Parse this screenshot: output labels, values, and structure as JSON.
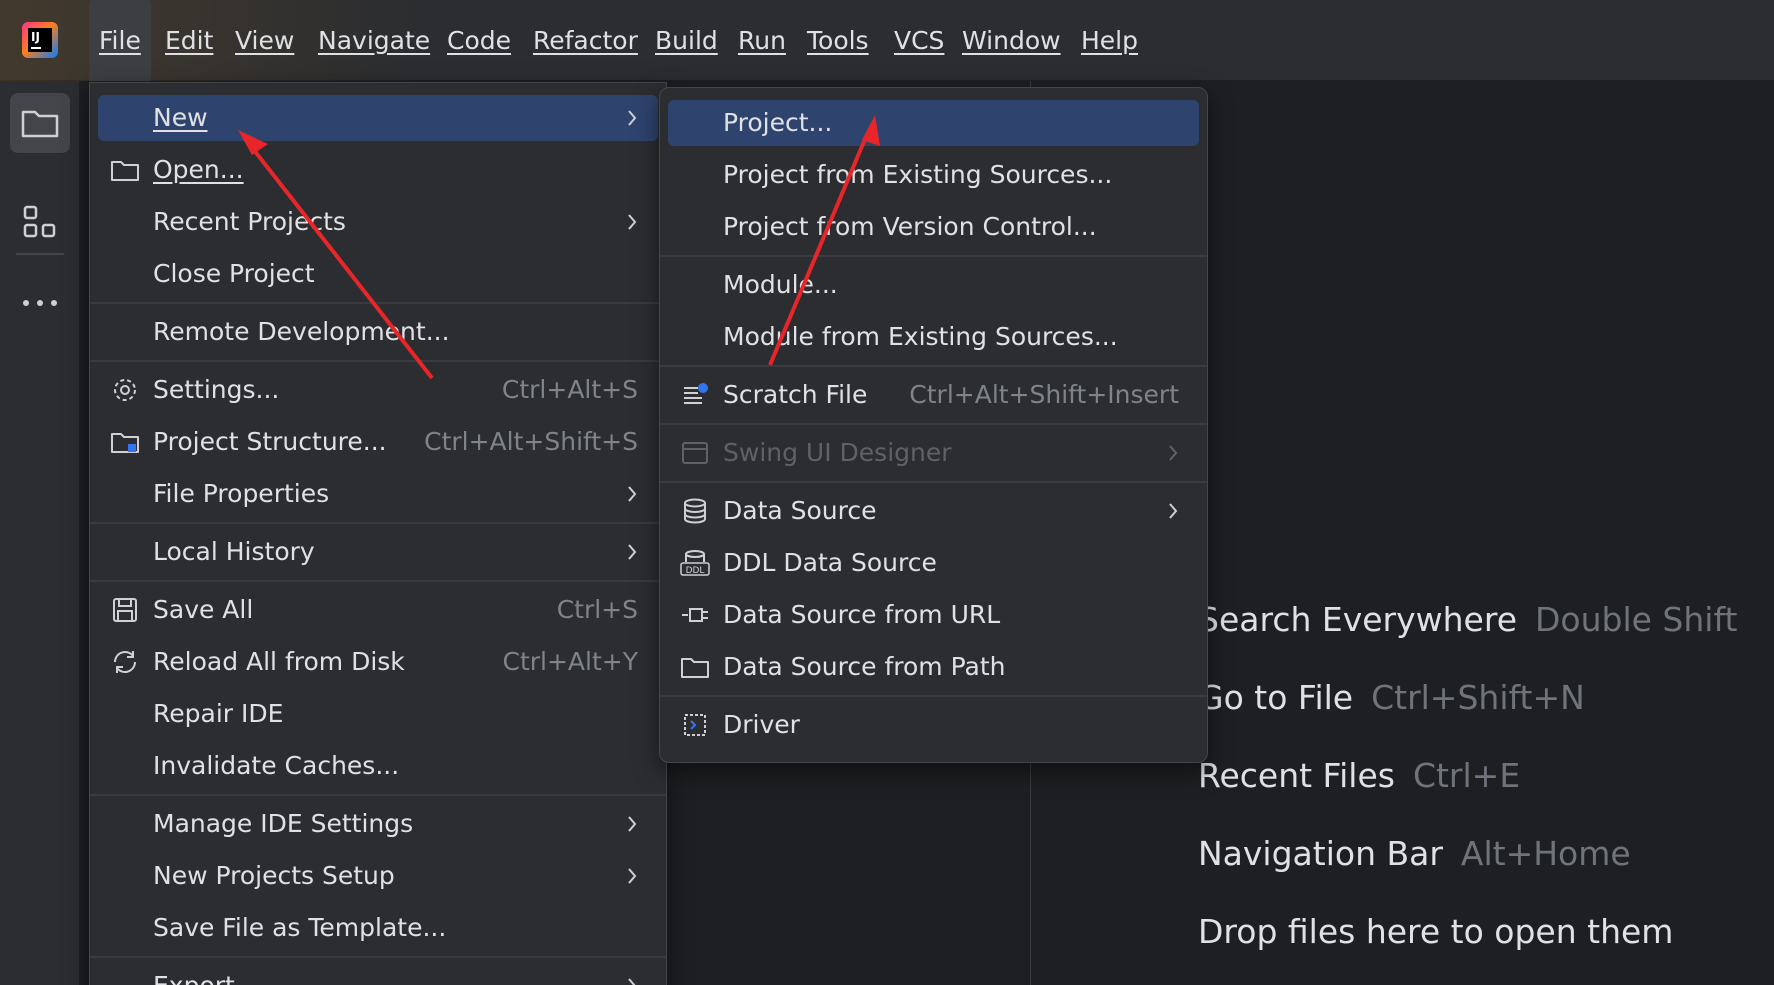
{
  "menubar": {
    "items": [
      "File",
      "Edit",
      "View",
      "Navigate",
      "Code",
      "Refactor",
      "Build",
      "Run",
      "Tools",
      "VCS",
      "Window",
      "Help"
    ]
  },
  "file_menu": {
    "items": {
      "new": "New",
      "open": "Open...",
      "recent_projects": "Recent Projects",
      "close_project": "Close Project",
      "remote_development": "Remote Development...",
      "settings": "Settings...",
      "project_structure": "Project Structure...",
      "file_properties": "File Properties",
      "local_history": "Local History",
      "save_all": "Save All",
      "reload_all": "Reload All from Disk",
      "repair_ide": "Repair IDE",
      "invalidate_caches": "Invalidate Caches...",
      "manage_ide_settings": "Manage IDE Settings",
      "new_projects_setup": "New Projects Setup",
      "save_as_template": "Save File as Template...",
      "export": "Export"
    },
    "shortcuts": {
      "settings": "Ctrl+Alt+S",
      "project_structure": "Ctrl+Alt+Shift+S",
      "save_all": "Ctrl+S",
      "reload_all": "Ctrl+Alt+Y"
    }
  },
  "new_submenu": {
    "items": {
      "project": "Project...",
      "project_existing": "Project from Existing Sources...",
      "project_vcs": "Project from Version Control...",
      "module": "Module...",
      "module_existing": "Module from Existing Sources...",
      "scratch_file": "Scratch File",
      "swing_ui": "Swing UI Designer",
      "data_source": "Data Source",
      "ddl_data_source": "DDL Data Source",
      "data_source_url": "Data Source from URL",
      "data_source_path": "Data Source from Path",
      "driver": "Driver"
    },
    "shortcuts": {
      "scratch_file": "Ctrl+Alt+Shift+Insert"
    }
  },
  "hints": [
    {
      "label": "Search Everywhere",
      "shortcut": "Double Shift"
    },
    {
      "label": "Go to File",
      "shortcut": "Ctrl+Shift+N"
    },
    {
      "label": "Recent Files",
      "shortcut": "Ctrl+E"
    },
    {
      "label": "Navigation Bar",
      "shortcut": "Alt+Home"
    },
    {
      "label": "Drop files here to open them",
      "shortcut": ""
    }
  ],
  "colors": {
    "background": "#1e1f22",
    "panel": "#2b2d30",
    "highlight": "#2e436e",
    "annotation_arrow": "#e8262a"
  }
}
